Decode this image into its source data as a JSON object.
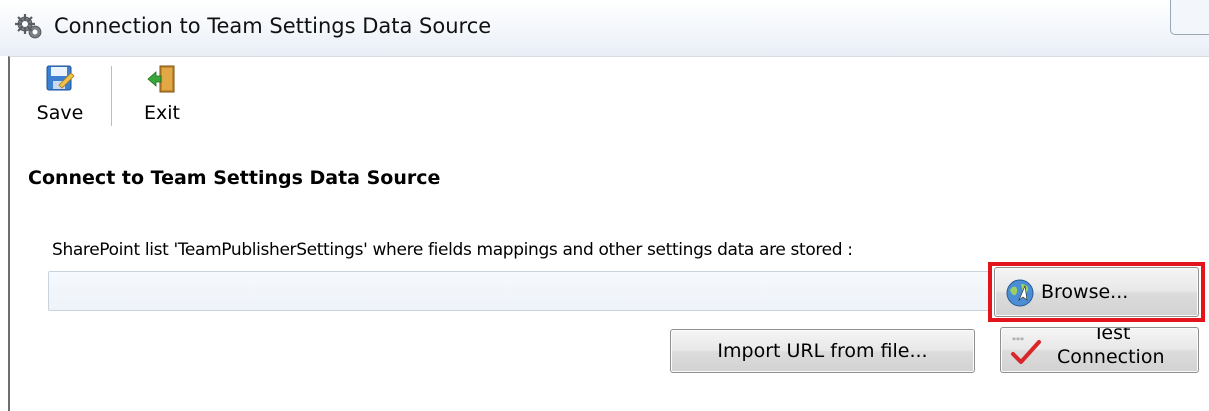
{
  "window": {
    "title": "Connection to Team Settings Data Source"
  },
  "toolbar": {
    "save_label": "Save",
    "exit_label": "Exit"
  },
  "form": {
    "section_title": "Connect to Team Settings Data Source",
    "field_label": "SharePoint list 'TeamPublisherSettings' where fields mappings and other settings data are stored :",
    "url_value": "",
    "browse_label": "Browse...",
    "import_label": "Import URL from file...",
    "test_label_line1": "Test",
    "test_label_line2": "Connection"
  },
  "colors": {
    "highlight": "#e3151a",
    "input_bg": "#eef3f9"
  },
  "icons": {
    "title": "gears-icon",
    "save": "save-disk-icon",
    "exit": "exit-door-icon",
    "browse": "browse-globe-icon",
    "test": "test-check-icon"
  }
}
